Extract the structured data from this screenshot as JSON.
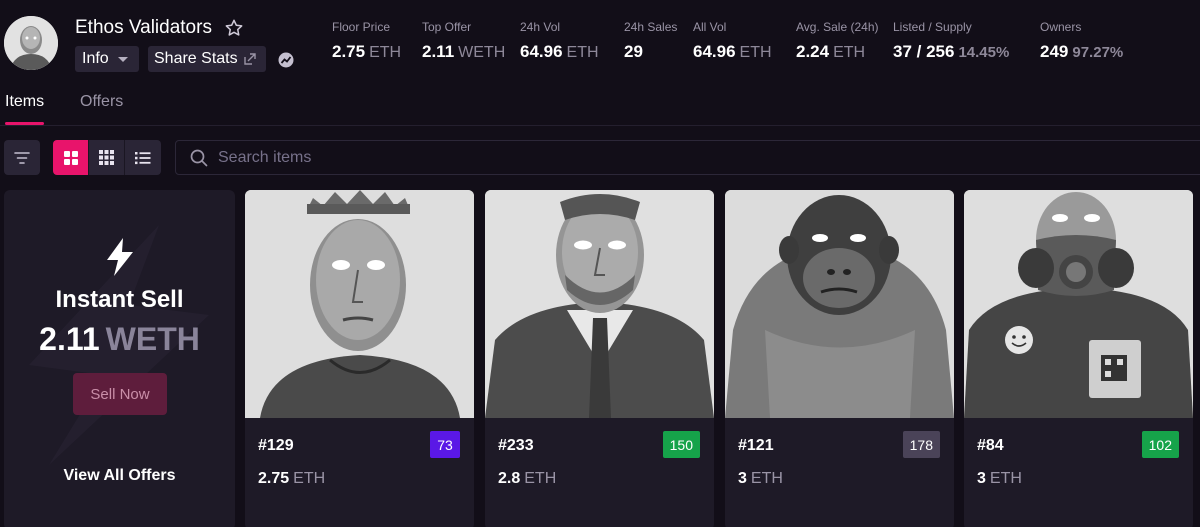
{
  "collection": {
    "name": "Ethos Validators",
    "info_label": "Info",
    "share_label": "Share Stats"
  },
  "stats": [
    {
      "label": "Floor Price",
      "value": "2.75",
      "unit": "ETH",
      "pct": ""
    },
    {
      "label": "Top Offer",
      "value": "2.11",
      "unit": "WETH",
      "pct": ""
    },
    {
      "label": "24h Vol",
      "value": "64.96",
      "unit": "ETH",
      "pct": ""
    },
    {
      "label": "24h Sales",
      "value": "29",
      "unit": "",
      "pct": ""
    },
    {
      "label": "All Vol",
      "value": "64.96",
      "unit": "ETH",
      "pct": ""
    },
    {
      "label": "Avg. Sale (24h)",
      "value": "2.24",
      "unit": "ETH",
      "pct": ""
    },
    {
      "label": "Listed / Supply",
      "value": "37 / 256",
      "unit": "",
      "pct": "14.45%"
    },
    {
      "label": "Owners",
      "value": "249",
      "unit": "",
      "pct": "97.27%"
    }
  ],
  "tabs": [
    {
      "label": "Items",
      "active": true
    },
    {
      "label": "Offers",
      "active": false
    }
  ],
  "search": {
    "placeholder": "Search items"
  },
  "instant_sell": {
    "title": "Instant Sell",
    "price": "2.11",
    "currency": "WETH",
    "button": "Sell Now",
    "view_all": "View All Offers"
  },
  "items": [
    {
      "id": "#129",
      "rank": "73",
      "rank_color": "#5a18e6",
      "price": "2.75",
      "currency": "ETH",
      "art": "crown"
    },
    {
      "id": "#233",
      "rank": "150",
      "rank_color": "#16a34a",
      "price": "2.8",
      "currency": "ETH",
      "art": "suit"
    },
    {
      "id": "#121",
      "rank": "178",
      "rank_color": "#4a4358",
      "price": "3",
      "currency": "ETH",
      "art": "ape"
    },
    {
      "id": "#84",
      "rank": "102",
      "rank_color": "#16a34a",
      "price": "3",
      "currency": "ETH",
      "art": "gasmask"
    }
  ],
  "colors": {
    "background": "#120e18",
    "card": "#1e1a27",
    "accent": "#e8146b"
  }
}
